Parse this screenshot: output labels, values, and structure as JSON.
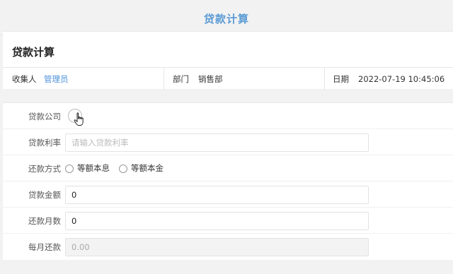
{
  "header": {
    "title": "贷款计算"
  },
  "card": {
    "heading": "贷款计算",
    "collector_label": "收集人",
    "collector_value": "管理员",
    "department_label": "部门",
    "department_value": "销售部",
    "date_label": "日期",
    "date_value": "2022-07-19 10:45:06"
  },
  "form": {
    "company_label": "贷款公司",
    "rate_label": "贷款利率",
    "rate_placeholder": "请输入贷款利率",
    "method_label": "还款方式",
    "method_options": [
      "等额本息",
      "等额本金"
    ],
    "amount_label": "贷款金额",
    "amount_value": "0",
    "months_label": "还款月数",
    "months_value": "0",
    "monthly_label": "每月还款",
    "monthly_value": "0.00"
  },
  "colors": {
    "accent": "#5b9bd5",
    "link": "#4a90d9"
  }
}
